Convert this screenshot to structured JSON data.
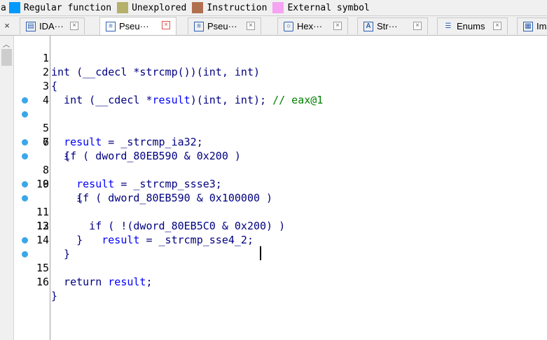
{
  "legend": {
    "cut_text": "a",
    "items": [
      {
        "label": "Regular function",
        "color": "#0099ff"
      },
      {
        "label": "Unexplored",
        "color": "#b5b06a"
      },
      {
        "label": "Instruction",
        "color": "#b07050"
      },
      {
        "label": "External symbol",
        "color": "#f5a3f2"
      }
    ]
  },
  "tabs": {
    "close_left": "×",
    "items": [
      {
        "label": "IDA···",
        "icon": "ida-view-icon",
        "active": false
      },
      {
        "label": "Pseu···",
        "icon": "pseudocode-icon",
        "active": true
      },
      {
        "label": "Pseu···",
        "icon": "pseudocode-icon",
        "active": false
      },
      {
        "label": "Hex···",
        "icon": "hex-view-icon",
        "active": false
      },
      {
        "label": "Str···",
        "icon": "strings-icon",
        "active": false
      },
      {
        "label": "Enums",
        "icon": "enums-icon",
        "active": false
      },
      {
        "label": "Im",
        "icon": "imports-icon",
        "active": false
      }
    ]
  },
  "code": {
    "lines": [
      {
        "num": "1",
        "bp": false,
        "text": "int (__cdecl *strcmp())(int, int)"
      },
      {
        "num": "2",
        "bp": false,
        "text": "{"
      },
      {
        "num": "3",
        "bp": false,
        "text": "  int (__cdecl *result)(int, int); // eax@1"
      },
      {
        "num": "4",
        "bp": false,
        "text": ""
      },
      {
        "num": "5",
        "bp": true,
        "text": "  result = _strcmp_ia32;"
      },
      {
        "num": "6",
        "bp": true,
        "text": "  if ( dword_80EB590 & 0x200 )"
      },
      {
        "num": "7",
        "bp": false,
        "text": "  {"
      },
      {
        "num": "8",
        "bp": true,
        "text": "    result = _strcmp_ssse3;"
      },
      {
        "num": "9",
        "bp": true,
        "text": "    if ( dword_80EB590 & 0x100000 )"
      },
      {
        "num": "10",
        "bp": false,
        "text": "    {"
      },
      {
        "num": "11",
        "bp": true,
        "text": "      if ( !(dword_80EB5C0 & 0x200) )"
      },
      {
        "num": "12",
        "bp": true,
        "text": "        result = _strcmp_sse4_2;"
      },
      {
        "num": "13",
        "bp": false,
        "text": "    }"
      },
      {
        "num": "14",
        "bp": false,
        "text": "  }"
      },
      {
        "num": "15",
        "bp": true,
        "text": "  return result;"
      },
      {
        "num": "16",
        "bp": true,
        "text": "}"
      }
    ]
  }
}
